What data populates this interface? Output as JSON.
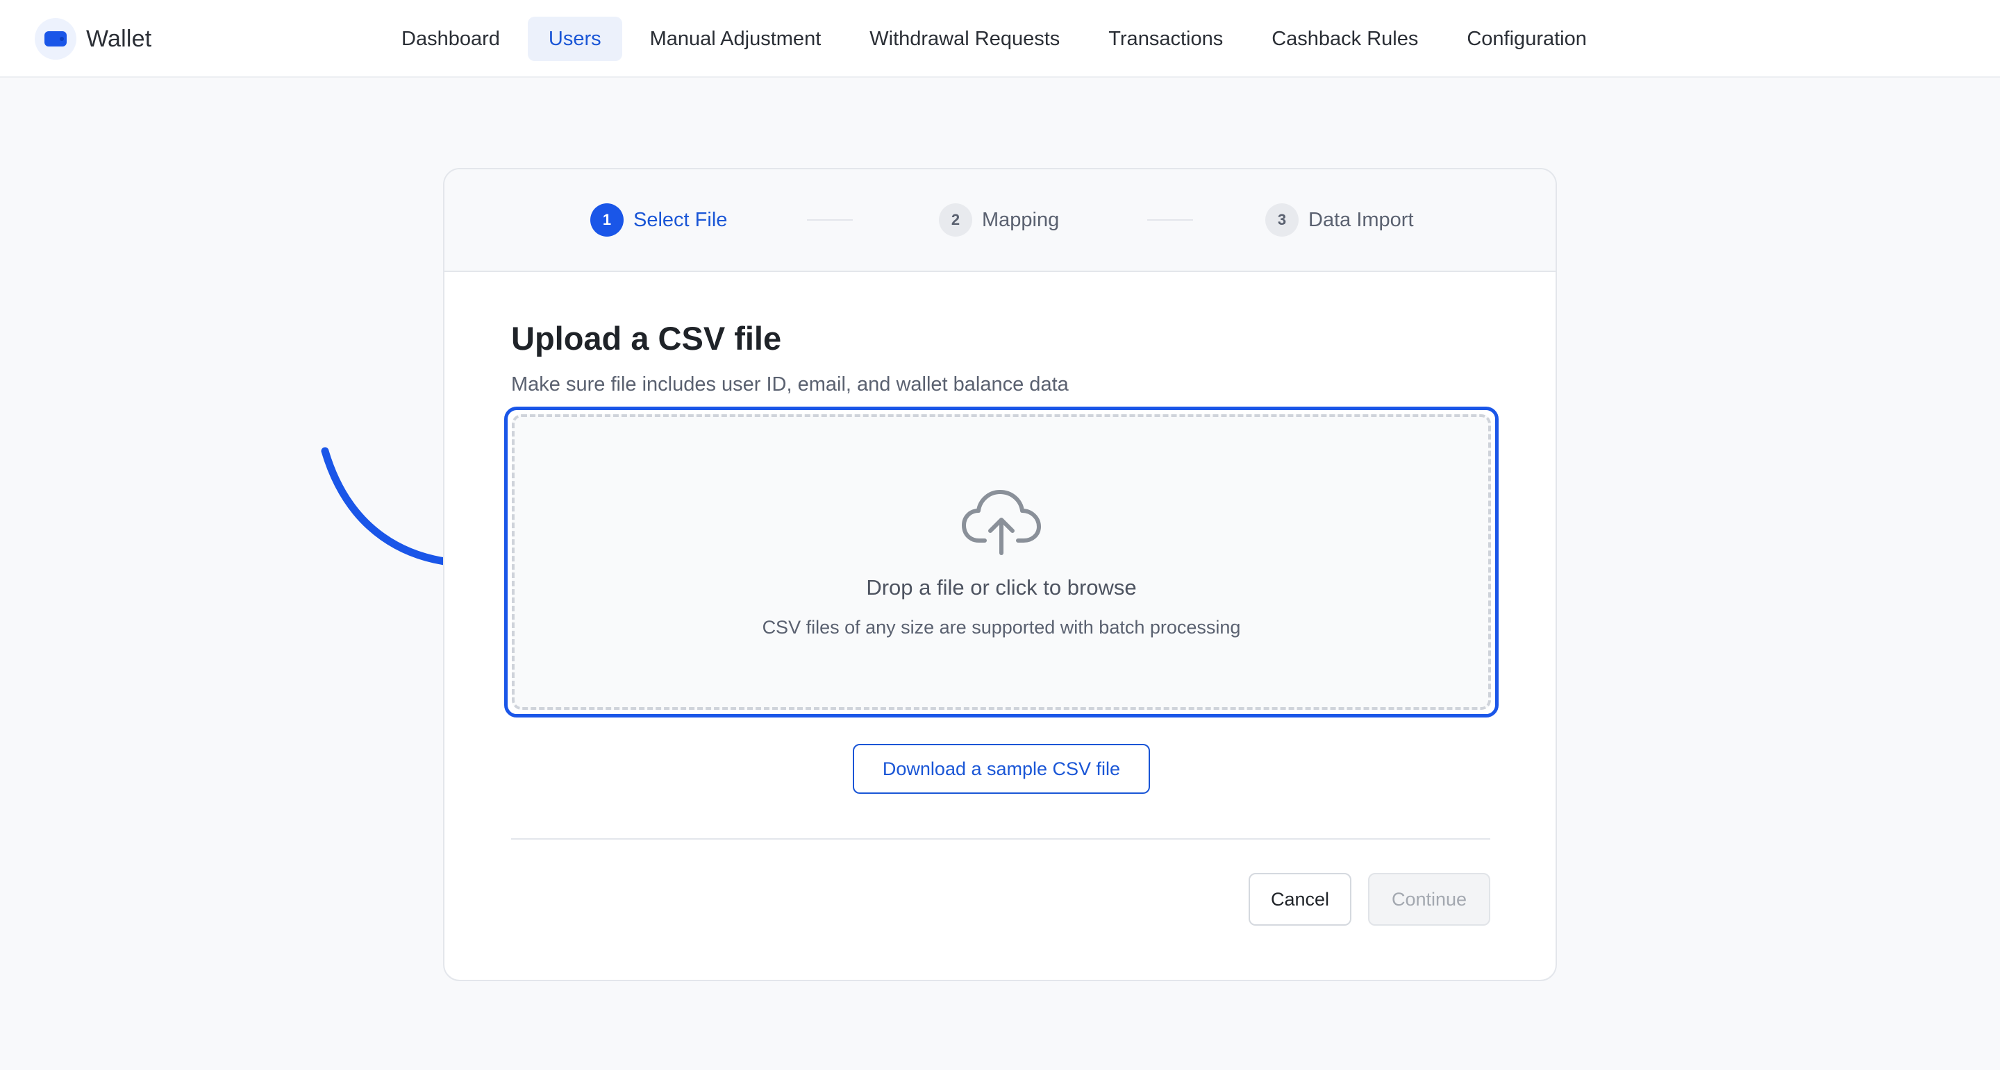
{
  "app": {
    "name": "Wallet",
    "logo_icon": "wallet-icon",
    "accent_color": "#1a56e8"
  },
  "nav": {
    "items": [
      {
        "label": "Dashboard",
        "active": false
      },
      {
        "label": "Users",
        "active": true
      },
      {
        "label": "Manual Adjustment",
        "active": false
      },
      {
        "label": "Withdrawal Requests",
        "active": false
      },
      {
        "label": "Transactions",
        "active": false
      },
      {
        "label": "Cashback Rules",
        "active": false
      },
      {
        "label": "Configuration",
        "active": false
      }
    ]
  },
  "stepper": {
    "steps": [
      {
        "number": "1",
        "label": "Select File",
        "active": true
      },
      {
        "number": "2",
        "label": "Mapping",
        "active": false
      },
      {
        "number": "3",
        "label": "Data Import",
        "active": false
      }
    ]
  },
  "upload": {
    "title": "Upload a CSV file",
    "subtitle": "Make sure file includes user ID, email, and wallet balance data",
    "dropzone": {
      "icon": "cloud-upload-icon",
      "primary_text": "Drop a file or click to browse",
      "secondary_text": "CSV files of any size are supported with batch processing"
    },
    "sample_button_label": "Download a sample CSV file"
  },
  "footer": {
    "cancel_label": "Cancel",
    "continue_label": "Continue",
    "continue_disabled": true
  },
  "annotation": {
    "icon": "curved-arrow-icon",
    "color": "#1a56e8"
  }
}
